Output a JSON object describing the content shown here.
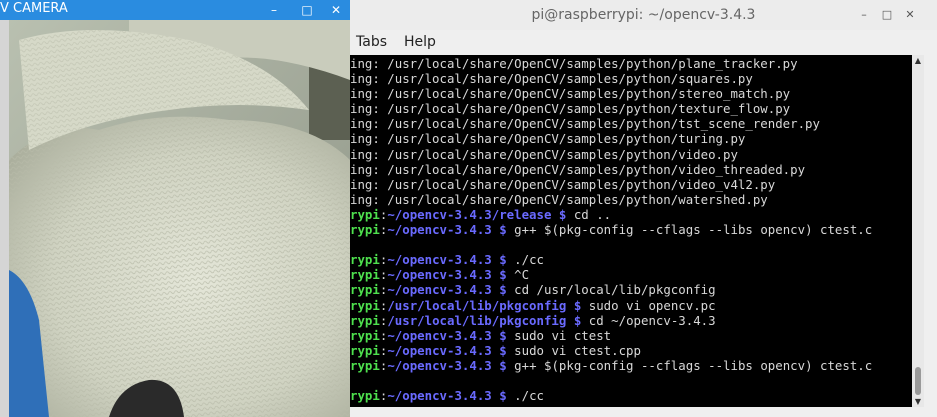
{
  "camera_window": {
    "title": "V CAMERA",
    "controls": {
      "minimize": "–",
      "maximize": "□",
      "close": "✕"
    }
  },
  "terminal_window": {
    "title": "pi@raspberrypi: ~/opencv-3.4.3",
    "controls": {
      "minimize": "–",
      "maximize": "□",
      "close": "✕"
    },
    "menu": [
      "Tabs",
      "Help"
    ],
    "output_lines": [
      "ing: /usr/local/share/OpenCV/samples/python/plane_tracker.py",
      "ing: /usr/local/share/OpenCV/samples/python/squares.py",
      "ing: /usr/local/share/OpenCV/samples/python/stereo_match.py",
      "ing: /usr/local/share/OpenCV/samples/python/texture_flow.py",
      "ing: /usr/local/share/OpenCV/samples/python/tst_scene_render.py",
      "ing: /usr/local/share/OpenCV/samples/python/turing.py",
      "ing: /usr/local/share/OpenCV/samples/python/video.py",
      "ing: /usr/local/share/OpenCV/samples/python/video_threaded.py",
      "ing: /usr/local/share/OpenCV/samples/python/video_v4l2.py",
      "ing: /usr/local/share/OpenCV/samples/python/watershed.py"
    ],
    "prompt_lines": [
      {
        "user": "rypi",
        "path": "~/opencv-3.4.3/release",
        "cmd": "cd .."
      },
      {
        "user": "rypi",
        "path": "~/opencv-3.4.3",
        "cmd": "g++ $(pkg-config --cflags --libs opencv) ctest.c"
      },
      {
        "blank": true
      },
      {
        "user": "rypi",
        "path": "~/opencv-3.4.3",
        "cmd": "./cc"
      },
      {
        "user": "rypi",
        "path": "~/opencv-3.4.3",
        "cmd": "^C"
      },
      {
        "user": "rypi",
        "path": "~/opencv-3.4.3",
        "cmd": "cd /usr/local/lib/pkgconfig"
      },
      {
        "user": "rypi",
        "path": "/usr/local/lib/pkgconfig",
        "cmd": "sudo vi opencv.pc"
      },
      {
        "user": "rypi",
        "path": "/usr/local/lib/pkgconfig",
        "cmd": "cd ~/opencv-3.4.3"
      },
      {
        "user": "rypi",
        "path": "~/opencv-3.4.3",
        "cmd": "sudo vi ctest"
      },
      {
        "user": "rypi",
        "path": "~/opencv-3.4.3",
        "cmd": "sudo vi ctest.cpp"
      },
      {
        "user": "rypi",
        "path": "~/opencv-3.4.3",
        "cmd": "g++ $(pkg-config --cflags --libs opencv) ctest.c"
      },
      {
        "blank": true
      },
      {
        "user": "rypi",
        "path": "~/opencv-3.4.3",
        "cmd": "./cc"
      }
    ],
    "prompt_symbol": "$",
    "colors": {
      "user": "#4ee04e",
      "path": "#6a6aff",
      "text": "#d8d8d8",
      "background": "#000000"
    }
  }
}
